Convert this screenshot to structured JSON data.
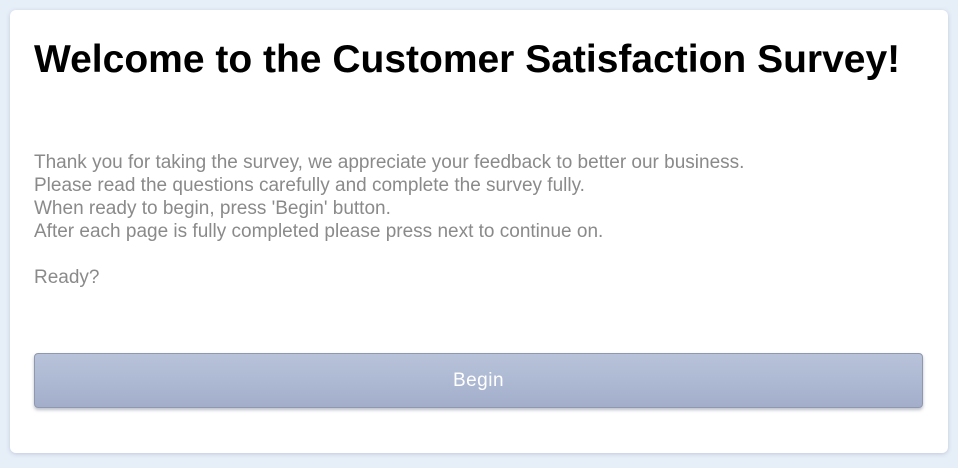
{
  "survey": {
    "title": "Welcome to the Customer Satisfaction Survey!",
    "intro_lines": [
      "Thank you for taking the survey, we appreciate your feedback to better our business.",
      "Please read the questions carefully and complete the survey fully.",
      "When ready to begin, press 'Begin' button.",
      "After each page is fully completed please press next to continue on."
    ],
    "ready_text": "Ready?",
    "begin_label": "Begin"
  },
  "colors": {
    "page_background": "#e6eef8",
    "card_background": "#ffffff",
    "body_text": "#8a8a8a",
    "button_top": "#b8c3da",
    "button_bottom": "#a3aecb",
    "button_text": "#ffffff"
  }
}
